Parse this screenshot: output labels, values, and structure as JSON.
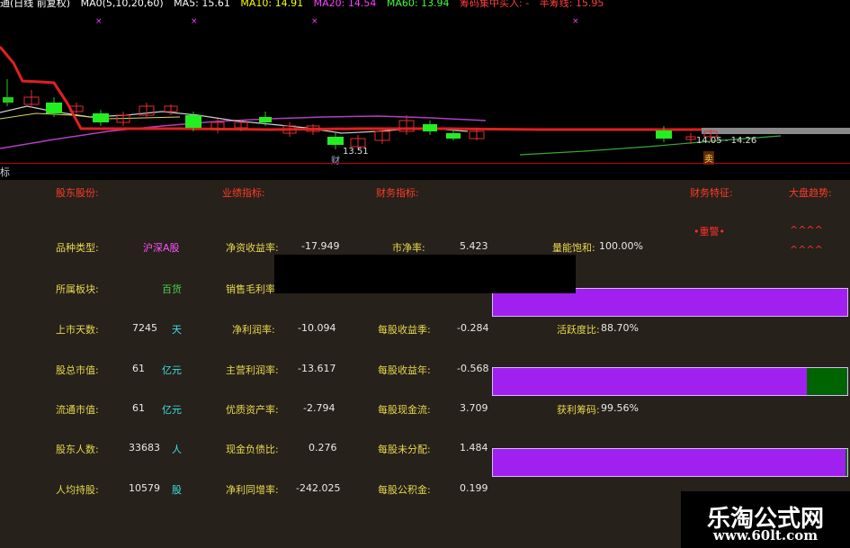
{
  "chart": {
    "legend": [
      {
        "text": "通(日线 前复权)",
        "color": "#ffffff"
      },
      {
        "text": "MA0(5,10,20,60)",
        "color": "#ffffff"
      },
      {
        "text": "MA5: 15.61",
        "color": "#ffffff"
      },
      {
        "text": "MA10: 14.91",
        "color": "#ffff00"
      },
      {
        "text": "MA20: 14.54",
        "color": "#ff40ff"
      },
      {
        "text": "MA60: 13.94",
        "color": "#40ff40"
      },
      {
        "text": "筹码集中买入: -",
        "color": "#ff4040"
      },
      {
        "text": "半筹线: 15.95",
        "color": "#ff4040"
      }
    ],
    "low_label": "13.51",
    "range_label": "14.05 - 14.26",
    "tag_cai": "财",
    "tag_mai": "卖",
    "axis_label": "标"
  },
  "panel": {
    "headers": {
      "shareholders": "股东股份:",
      "performance": "业绩指标:",
      "financial": "财务指标:",
      "features": "财务特征:",
      "market": "大盘趋势:"
    },
    "alert": "•重警•",
    "trend_arrows": [
      "^^^^",
      "^^^^"
    ],
    "col1": [
      {
        "label": "品种类型:",
        "value": "沪深A股",
        "unit": ""
      },
      {
        "label": "所属板块:",
        "value": "百货",
        "unit": ""
      },
      {
        "label": "上市天数:",
        "value": "7245",
        "unit": "天"
      },
      {
        "label": "股总市值:",
        "value": "61",
        "unit": "亿元"
      },
      {
        "label": "流通市值:",
        "value": "61",
        "unit": "亿元"
      },
      {
        "label": "股东人数:",
        "value": "33683",
        "unit": "人"
      },
      {
        "label": "人均持股:",
        "value": "10579",
        "unit": "股"
      }
    ],
    "col2": [
      {
        "label": "净资收益率:",
        "value": "-17.949"
      },
      {
        "label": "销售毛利率:",
        "value": ""
      },
      {
        "label": "净利润率:",
        "value": "-10.094"
      },
      {
        "label": "主营利润率:",
        "value": "-13.617"
      },
      {
        "label": "优质资产率:",
        "value": "-2.794"
      },
      {
        "label": "现金负债比:",
        "value": "0.276"
      },
      {
        "label": "净利同增率:",
        "value": "-242.025"
      }
    ],
    "col3": [
      {
        "label": "市净率:",
        "value": "5.423"
      },
      {
        "label": "",
        "value": ""
      },
      {
        "label": "每股收益季:",
        "value": "-0.284"
      },
      {
        "label": "每股收益年:",
        "value": "-0.568"
      },
      {
        "label": "每股现金流:",
        "value": "3.709"
      },
      {
        "label": "每股未分配:",
        "value": "1.484"
      },
      {
        "label": "每股公积金:",
        "value": "0.199"
      }
    ],
    "bars": [
      {
        "label": "量能饱和:",
        "value": "100.00%",
        "fill": 1.0
      },
      {
        "label": "活跃度比:",
        "value": "88.70%",
        "fill": 0.887
      },
      {
        "label": "获利筹码:",
        "value": "99.56%",
        "fill": 0.9956
      }
    ]
  },
  "watermark": {
    "title": "乐淘公式网",
    "url": "www.60lt.com"
  }
}
